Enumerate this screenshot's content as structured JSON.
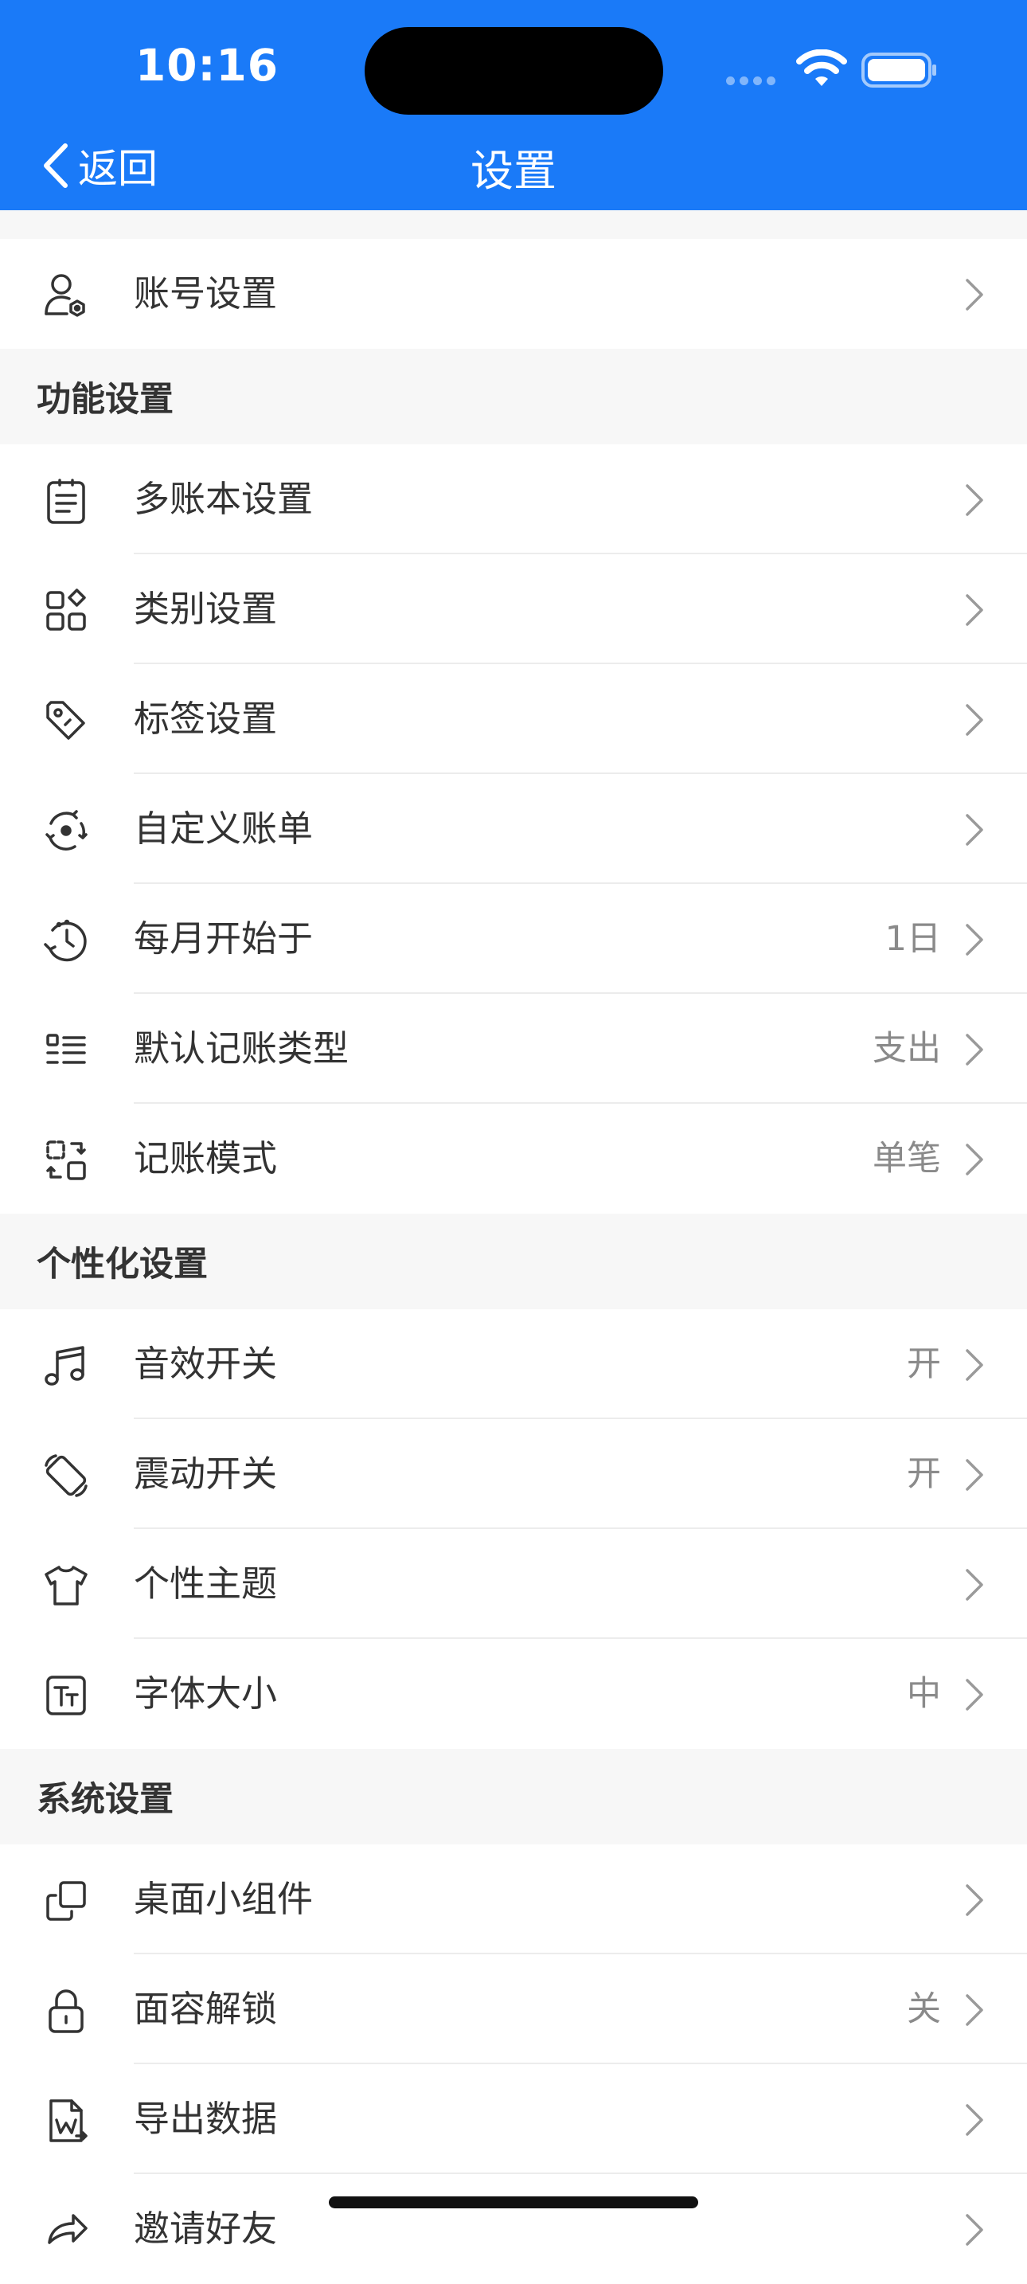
{
  "status_bar": {
    "time": "10:16"
  },
  "nav": {
    "back_label": "返回",
    "title": "设置"
  },
  "account": {
    "label": "账号设置",
    "icon": "account-settings-icon"
  },
  "sections": [
    {
      "title": "功能设置",
      "rows": [
        {
          "label": "多账本设置",
          "value": "",
          "icon": "ledger-icon"
        },
        {
          "label": "类别设置",
          "value": "",
          "icon": "category-icon"
        },
        {
          "label": "标签设置",
          "value": "",
          "icon": "tag-icon"
        },
        {
          "label": "自定义账单",
          "value": "",
          "icon": "custom-bill-icon"
        },
        {
          "label": "每月开始于",
          "value": "1日",
          "icon": "month-start-icon"
        },
        {
          "label": "默认记账类型",
          "value": "支出",
          "icon": "list-icon"
        },
        {
          "label": "记账模式",
          "value": "单笔",
          "icon": "mode-icon"
        }
      ]
    },
    {
      "title": "个性化设置",
      "rows": [
        {
          "label": "音效开关",
          "value": "开",
          "icon": "music-icon"
        },
        {
          "label": "震动开关",
          "value": "开",
          "icon": "vibrate-icon"
        },
        {
          "label": "个性主题",
          "value": "",
          "icon": "shirt-icon"
        },
        {
          "label": "字体大小",
          "value": "中",
          "icon": "font-size-icon"
        }
      ]
    },
    {
      "title": "系统设置",
      "rows": [
        {
          "label": "桌面小组件",
          "value": "",
          "icon": "widget-icon"
        },
        {
          "label": "面容解锁",
          "value": "关",
          "icon": "lock-icon"
        },
        {
          "label": "导出数据",
          "value": "",
          "icon": "export-doc-icon"
        },
        {
          "label": "邀请好友",
          "value": "",
          "icon": "share-icon"
        }
      ]
    }
  ],
  "colors": {
    "accent": "#1a7af8",
    "background": "#f7f7f7",
    "value_text": "#8a8a8a"
  }
}
